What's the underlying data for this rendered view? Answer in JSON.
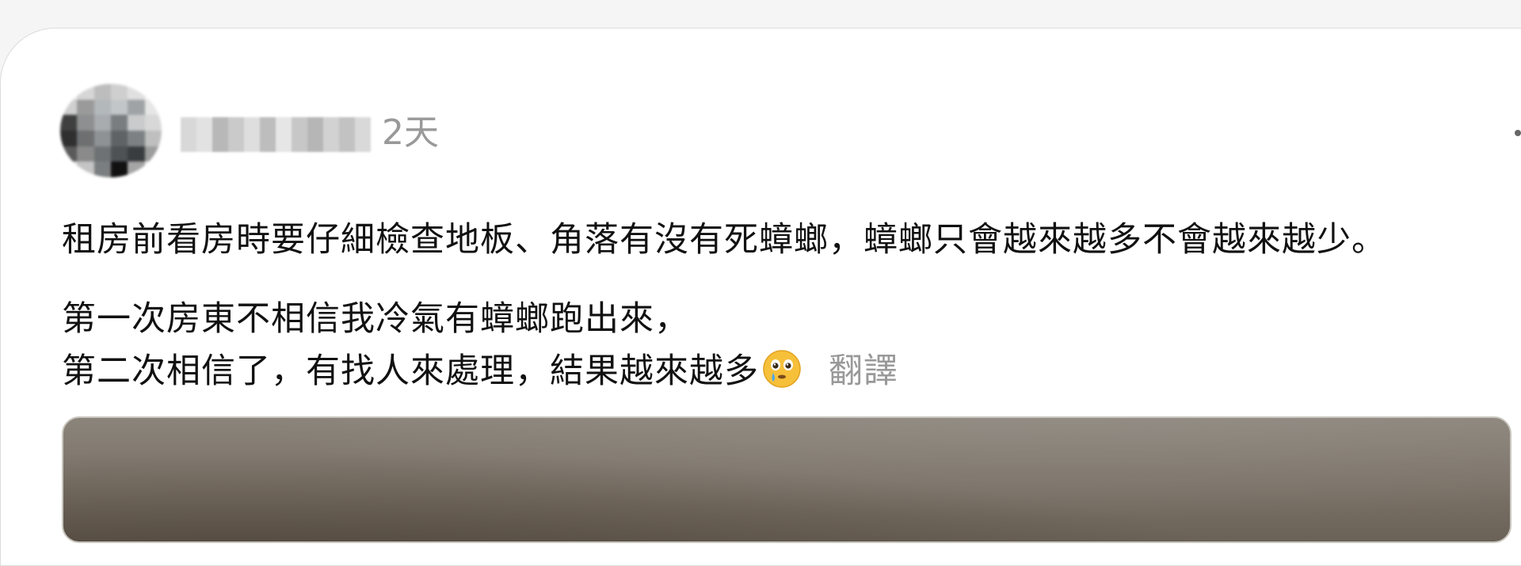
{
  "post": {
    "timestamp": "2天",
    "paragraph1": "租房前看房時要仔細檢查地板、角落有沒有死蟑螂，蟑螂只會越來越多不會越來越少。",
    "paragraph2_line1": "第一次房東不相信我冷氣有蟑螂跑出來，",
    "paragraph2_line2": "第二次相信了，有找人來處理，結果越來越多",
    "emoji": "crying-face-emoji",
    "translate_label": "翻譯"
  },
  "colors": {
    "page_background": "#f5f5f5",
    "card_background": "#ffffff",
    "text_primary": "#111111",
    "text_secondary": "#999999"
  }
}
